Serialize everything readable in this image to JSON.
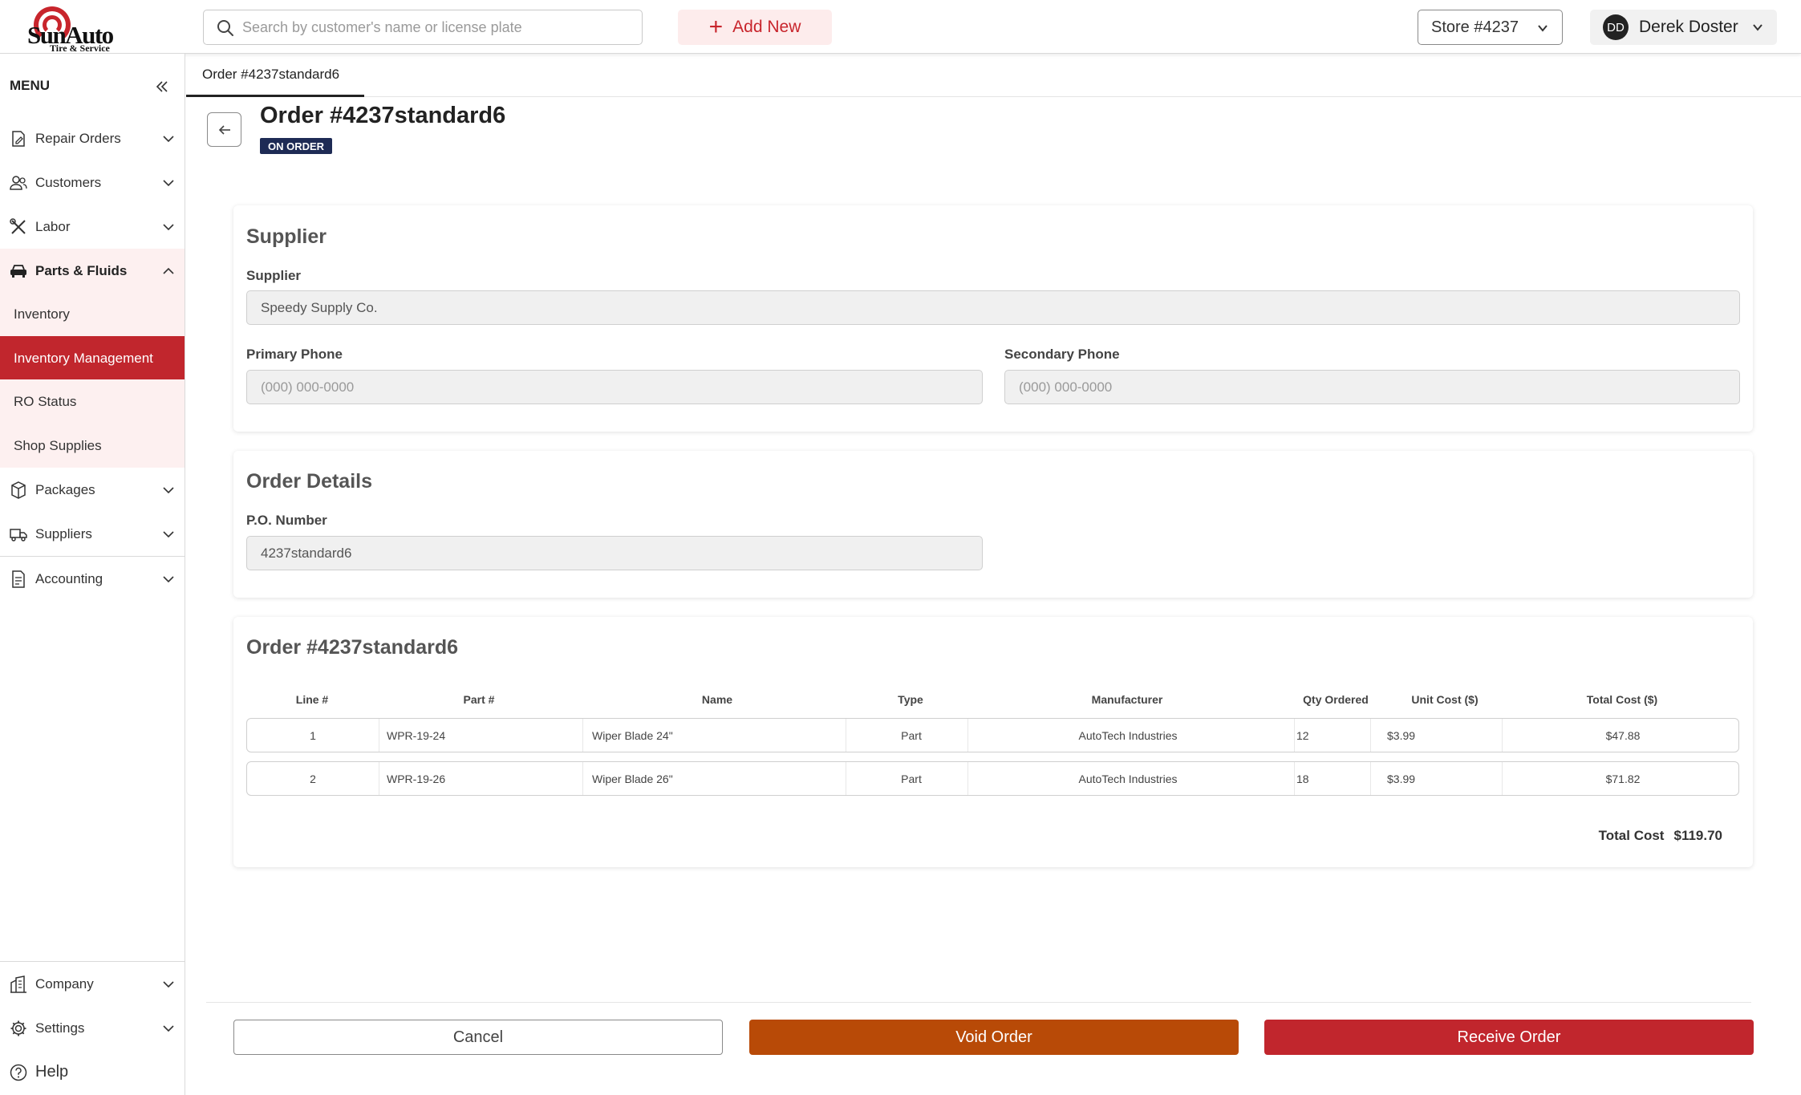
{
  "header": {
    "logo_text": "SunAuto",
    "logo_sub": "Tire & Service",
    "search_placeholder": "Search by customer's name or license plate",
    "add_new_label": "Add New",
    "store_label": "Store #4237",
    "user_initials": "DD",
    "user_name": "Derek Doster"
  },
  "sidebar": {
    "menu_label": "MENU",
    "items": [
      {
        "label": "Repair Orders",
        "icon": "repair-orders-icon"
      },
      {
        "label": "Customers",
        "icon": "customers-icon"
      },
      {
        "label": "Labor",
        "icon": "labor-icon"
      },
      {
        "label": "Parts & Fluids",
        "icon": "car-icon"
      },
      {
        "label": "Packages",
        "icon": "package-icon"
      },
      {
        "label": "Suppliers",
        "icon": "truck-icon"
      },
      {
        "label": "Accounting",
        "icon": "accounting-icon"
      }
    ],
    "sub_items": [
      "Inventory",
      "Inventory Management",
      "RO Status",
      "Shop Supplies"
    ],
    "active_sub_item": "Inventory Management",
    "bottom_items": [
      {
        "label": "Company",
        "icon": "building-icon"
      },
      {
        "label": "Settings",
        "icon": "gear-icon"
      },
      {
        "label": "Help",
        "icon": "help-icon"
      }
    ]
  },
  "tab": {
    "label": "Order #4237standard6"
  },
  "page": {
    "title": "Order #4237standard6",
    "status": "ON ORDER"
  },
  "supplier_card": {
    "title": "Supplier",
    "supplier_label": "Supplier",
    "supplier_value": "Speedy Supply Co.",
    "primary_phone_label": "Primary Phone",
    "primary_phone_placeholder": "(000) 000-0000",
    "secondary_phone_label": "Secondary Phone",
    "secondary_phone_placeholder": "(000) 000-0000"
  },
  "order_details_card": {
    "title": "Order Details",
    "po_label": "P.O. Number",
    "po_value": "4237standard6"
  },
  "order_table": {
    "title": "Order #4237standard6",
    "columns": [
      "Line #",
      "Part #",
      "Name",
      "Type",
      "Manufacturer",
      "Qty Ordered",
      "Unit Cost ($)",
      "Total Cost ($)"
    ],
    "rows": [
      {
        "line": "1",
        "part": "WPR-19-24",
        "name": "Wiper Blade 24\"",
        "type": "Part",
        "manufacturer": "AutoTech Industries",
        "qty": "12",
        "unit_cost": "$3.99",
        "total_cost": "$47.88"
      },
      {
        "line": "2",
        "part": "WPR-19-26",
        "name": "Wiper Blade 26\"",
        "type": "Part",
        "manufacturer": "AutoTech Industries",
        "qty": "18",
        "unit_cost": "$3.99",
        "total_cost": "$71.82"
      }
    ],
    "total_label": "Total Cost",
    "total_value": "$119.70"
  },
  "footer": {
    "cancel_label": "Cancel",
    "void_label": "Void Order",
    "receive_label": "Receive Order"
  },
  "colors": {
    "brand_red": "#c1262d",
    "void_orange": "#b84a07",
    "badge_navy": "#1e2b55"
  }
}
